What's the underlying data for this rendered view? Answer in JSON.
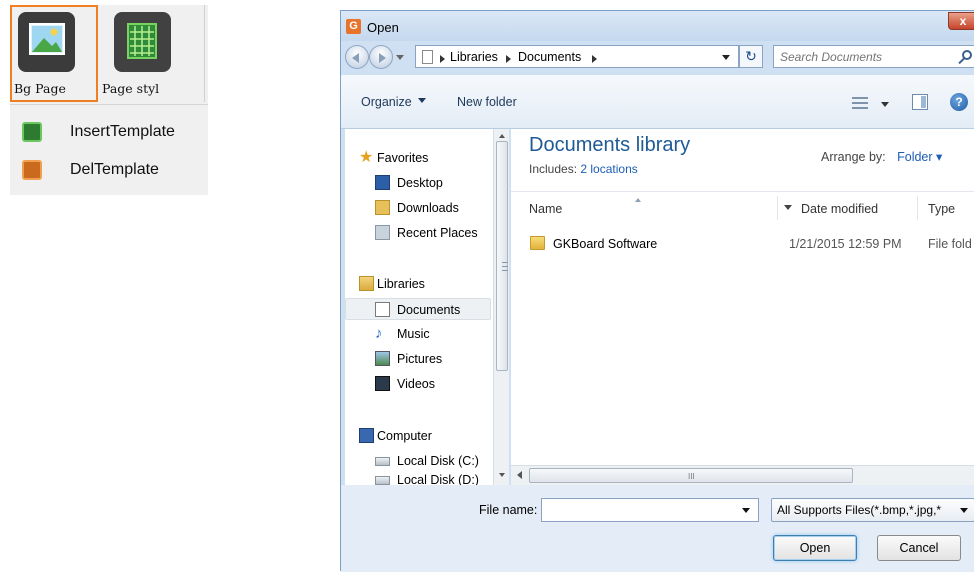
{
  "toolbar": {
    "buttons": [
      {
        "label": "Bg Page",
        "icon": "image-icon"
      },
      {
        "label": "Page styl",
        "icon": "grid-page-icon"
      }
    ],
    "menu": [
      {
        "label": "InsertTemplate",
        "icon": "insert-template-icon",
        "color": "#3f9a3a"
      },
      {
        "label": "DelTemplate",
        "icon": "delete-template-icon",
        "color": "#e88a2c"
      }
    ],
    "accent": "#f07e22"
  },
  "dialog": {
    "title": "Open",
    "close": "x",
    "breadcrumb": [
      "Libraries",
      "Documents"
    ],
    "search_placeholder": "Search Documents",
    "commands": {
      "organize": "Organize",
      "new_folder": "New folder"
    },
    "nav": {
      "favorites": "Favorites",
      "favorite_items": [
        "Desktop",
        "Downloads",
        "Recent Places"
      ],
      "libraries": "Libraries",
      "library_items": [
        "Documents",
        "Music",
        "Pictures",
        "Videos"
      ],
      "selected": "Documents",
      "computer": "Computer",
      "drives": [
        "Local Disk (C:)",
        "Local Disk (D:)"
      ]
    },
    "library": {
      "title": "Documents library",
      "includes_label": "Includes:",
      "includes_link": "2 locations",
      "arrange_label": "Arrange by:",
      "arrange_value": "Folder"
    },
    "columns": [
      "Name",
      "Date modified",
      "Type"
    ],
    "files": [
      {
        "name": "GKBoard Software",
        "date": "1/21/2015 12:59 PM",
        "type": "File fold"
      }
    ],
    "file_name_label": "File name:",
    "file_name_value": "",
    "file_type": "All Supports Files(*.bmp,*.jpg,*",
    "buttons": {
      "open": "Open",
      "cancel": "Cancel"
    }
  }
}
